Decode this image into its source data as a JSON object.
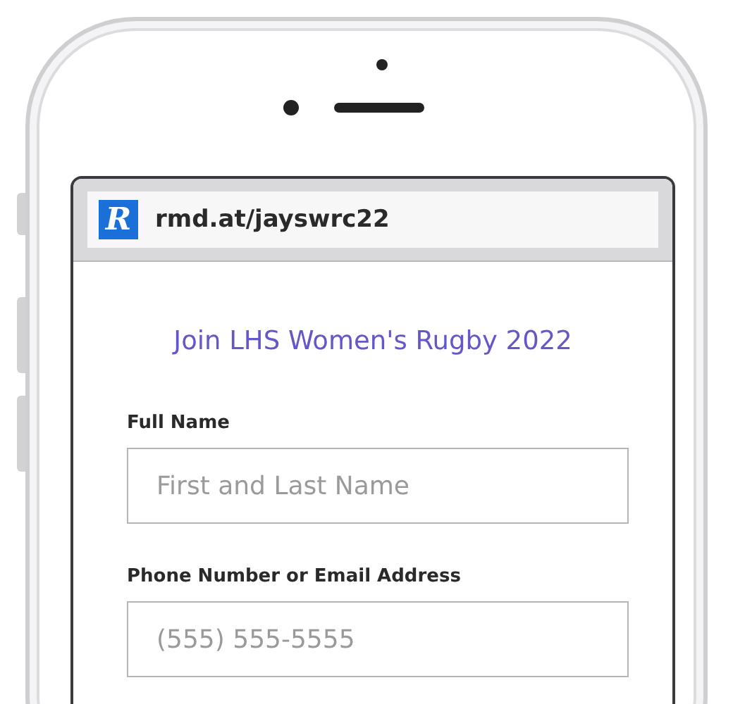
{
  "address_bar": {
    "logo": "R",
    "url": "rmd.at/jayswrc22"
  },
  "form": {
    "title": "Join LHS Women's Rugby 2022",
    "fields": [
      {
        "label": "Full Name",
        "placeholder": "First and Last Name"
      },
      {
        "label": "Phone Number or Email Address",
        "placeholder": "(555) 555-5555"
      }
    ]
  }
}
